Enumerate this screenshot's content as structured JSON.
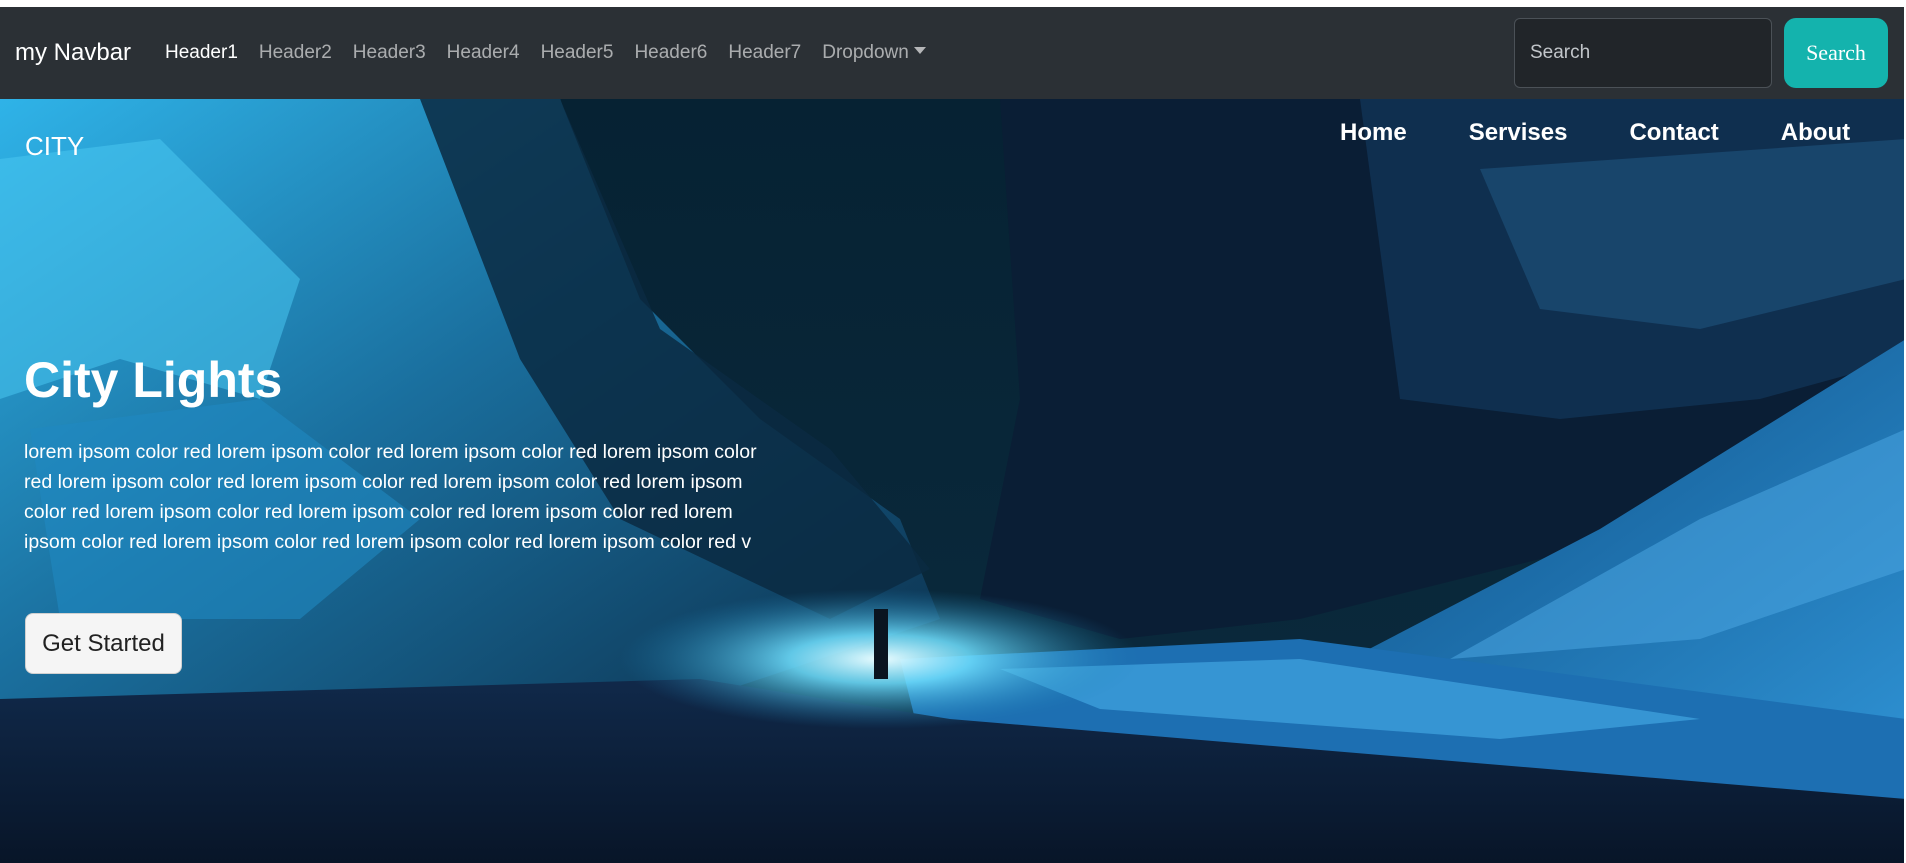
{
  "navbar": {
    "brand": "my Navbar",
    "links": [
      {
        "label": "Header1"
      },
      {
        "label": "Header2"
      },
      {
        "label": "Header3"
      },
      {
        "label": "Header4"
      },
      {
        "label": "Header5"
      },
      {
        "label": "Header6"
      },
      {
        "label": "Header7"
      }
    ],
    "dropdown_label": "Dropdown",
    "search": {
      "placeholder": "Search",
      "button_label": "Search"
    }
  },
  "hero": {
    "logo": "CITY",
    "nav": [
      {
        "label": "Home"
      },
      {
        "label": "Servises"
      },
      {
        "label": "Contact"
      },
      {
        "label": "About"
      }
    ],
    "title": "City Lights",
    "text": "lorem ipsom color red lorem ipsom color red lorem ipsom color red lorem ipsom color red lorem ipsom color red lorem ipsom color red lorem ipsom color red lorem ipsom color red lorem ipsom color red lorem ipsom color red lorem ipsom color red lorem ipsom color red lorem ipsom color red lorem ipsom color red lorem ipsom color red v",
    "cta_label": "Get Started"
  },
  "colors": {
    "navbar_bg": "#2b3035",
    "search_button": "#14b3ad",
    "hero_text": "#ffffff"
  }
}
